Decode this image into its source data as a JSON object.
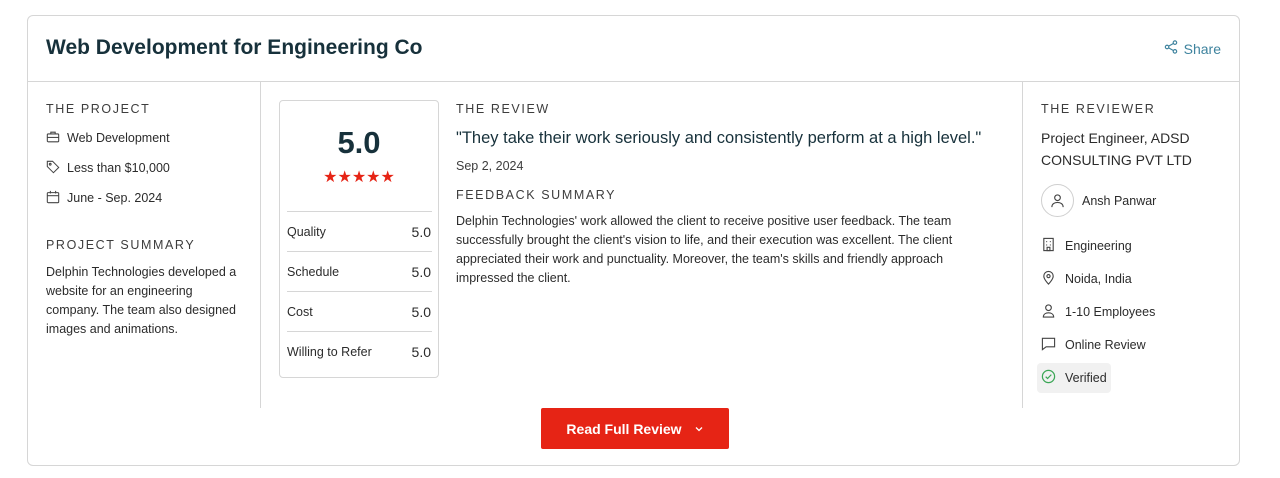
{
  "header": {
    "title": "Web Development for Engineering Co",
    "share_label": "Share"
  },
  "project": {
    "label": "THE PROJECT",
    "service": "Web Development",
    "budget": "Less than $10,000",
    "dates": "June - Sep. 2024",
    "summary_label": "PROJECT SUMMARY",
    "summary": "Delphin Technologies developed a website for an engineering company. The team also designed images and animations."
  },
  "rating": {
    "overall": "5.0",
    "stars": "★★★★★",
    "scores": [
      {
        "label": "Quality",
        "value": "5.0"
      },
      {
        "label": "Schedule",
        "value": "5.0"
      },
      {
        "label": "Cost",
        "value": "5.0"
      },
      {
        "label": "Willing to Refer",
        "value": "5.0"
      }
    ]
  },
  "review": {
    "label": "THE REVIEW",
    "quote": "\"They take their work seriously and consistently perform at a high level.\"",
    "date": "Sep 2, 2024",
    "feedback_label": "FEEDBACK SUMMARY",
    "feedback": "Delphin Technologies' work allowed the client to receive positive user feedback. The team successfully brought the client's vision to life, and their execution was excellent. The client appreciated their work and punctuality. Moreover, the team's skills and friendly approach impressed the client."
  },
  "reviewer": {
    "label": "THE REVIEWER",
    "title": "Project Engineer, ADSD CONSULTING PVT LTD",
    "name": "Ansh Panwar",
    "industry": "Engineering",
    "location": "Noida, India",
    "size": "1-10 Employees",
    "review_type": "Online Review",
    "verified": "Verified"
  },
  "button": {
    "label": "Read Full Review"
  },
  "colors": {
    "accent": "#e62415",
    "link": "#3e839e",
    "verified": "#3aa655"
  }
}
